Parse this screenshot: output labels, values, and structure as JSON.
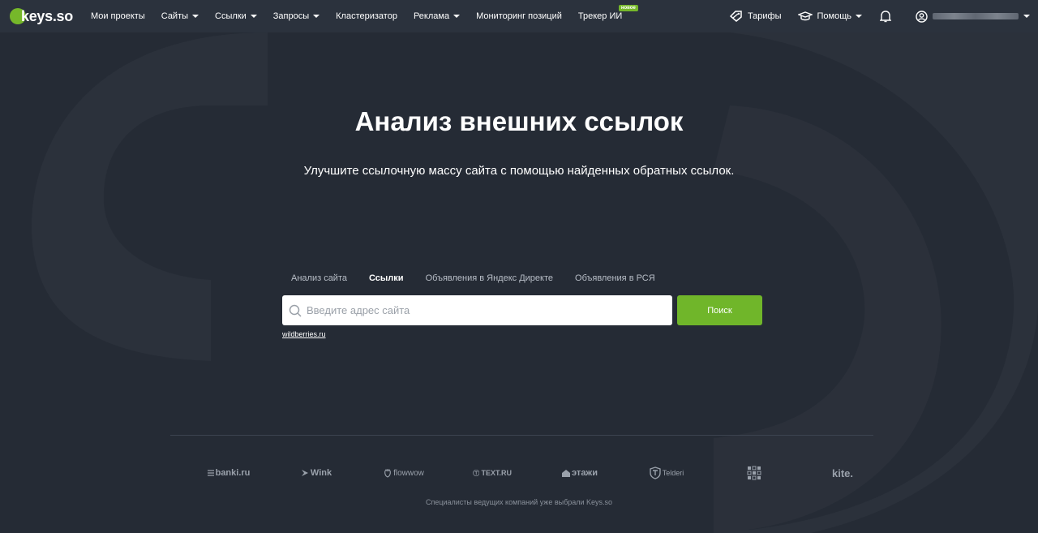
{
  "logo": {
    "text": "keys.so"
  },
  "nav": {
    "items": [
      {
        "label": "Мои проекты",
        "has_caret": false
      },
      {
        "label": "Сайты",
        "has_caret": true
      },
      {
        "label": "Ссылки",
        "has_caret": true
      },
      {
        "label": "Запросы",
        "has_caret": true
      },
      {
        "label": "Кластеризатор",
        "has_caret": false
      },
      {
        "label": "Реклама",
        "has_caret": true
      },
      {
        "label": "Мониторинг позиций",
        "has_caret": false
      },
      {
        "label": "Трекер ИИ",
        "has_caret": false,
        "badge": "новое"
      }
    ]
  },
  "right_nav": {
    "tariffs": "Тарифы",
    "help": "Помощь"
  },
  "hero": {
    "title": "Анализ внешних ссылок",
    "subtitle": "Улучшите ссылочную массу сайта с помощью найденных обратных ссылок."
  },
  "tabs": [
    {
      "label": "Анализ сайта",
      "active": false
    },
    {
      "label": "Ссылки",
      "active": true
    },
    {
      "label": "Объявления в Яндекс Директе",
      "active": false
    },
    {
      "label": "Объявления в РСЯ",
      "active": false
    }
  ],
  "search": {
    "placeholder": "Введите адрес сайта",
    "value": "",
    "button_label": "Поиск",
    "example": "wildberries.ru"
  },
  "brands": [
    "banki.ru",
    "Wink",
    "flowwow",
    "TEXT.RU",
    "этажи",
    "Telderi",
    "",
    "kite."
  ],
  "footer": {
    "text": "Специалисты ведущих компаний уже выбрали Keys.so"
  },
  "colors": {
    "background": "#252b35",
    "header": "#2b323d",
    "accent": "#76b82a",
    "button": "#70b62a"
  }
}
